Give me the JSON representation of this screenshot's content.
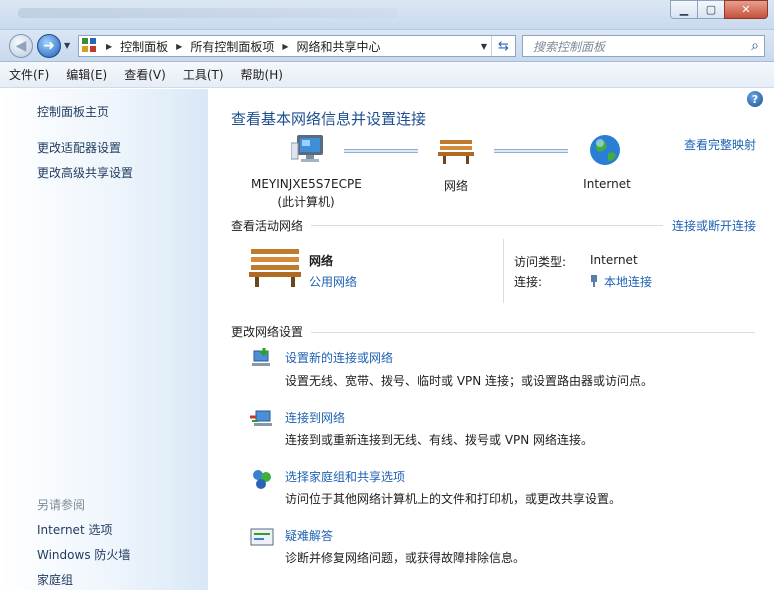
{
  "window": {
    "minimize": "▭",
    "restore": "▣",
    "close": "✕"
  },
  "nav": {
    "back_label": "◀",
    "forward_label": "▶",
    "breadcrumbs": [
      "控制面板",
      "所有控制面板项",
      "网络和共享中心"
    ],
    "search_placeholder": "搜索控制面板"
  },
  "menu": {
    "items": [
      "文件(F)",
      "编辑(E)",
      "查看(V)",
      "工具(T)",
      "帮助(H)"
    ]
  },
  "left": {
    "home": "控制面板主页",
    "links": [
      "更改适配器设置",
      "更改高级共享设置"
    ],
    "see_also_heading": "另请参阅",
    "see_also": [
      "Internet 选项",
      "Windows 防火墙",
      "家庭组"
    ]
  },
  "main": {
    "title": "查看基本网络信息并设置连接",
    "full_map": "查看完整映射",
    "map": {
      "computer_name": "MEYINJXE5S7ECPE",
      "computer_sub": "(此计算机)",
      "network": "网络",
      "internet": "Internet"
    },
    "active": {
      "heading": "查看活动网络",
      "connect_link": "连接或断开连接",
      "name": "网络",
      "type": "公用网络",
      "access_key": "访问类型:",
      "access_val": "Internet",
      "conn_key": "连接:",
      "conn_val": "本地连接"
    },
    "change": {
      "heading": "更改网络设置",
      "tasks": [
        {
          "title": "设置新的连接或网络",
          "desc": "设置无线、宽带、拨号、临时或 VPN 连接；或设置路由器或访问点。"
        },
        {
          "title": "连接到网络",
          "desc": "连接到或重新连接到无线、有线、拨号或 VPN 网络连接。"
        },
        {
          "title": "选择家庭组和共享选项",
          "desc": "访问位于其他网络计算机上的文件和打印机，或更改共享设置。"
        },
        {
          "title": "疑难解答",
          "desc": "诊断并修复网络问题，或获得故障排除信息。"
        }
      ]
    }
  },
  "colors": {
    "link": "#1e62b4",
    "title": "#1e4e91",
    "chrome": "#c9daee"
  }
}
